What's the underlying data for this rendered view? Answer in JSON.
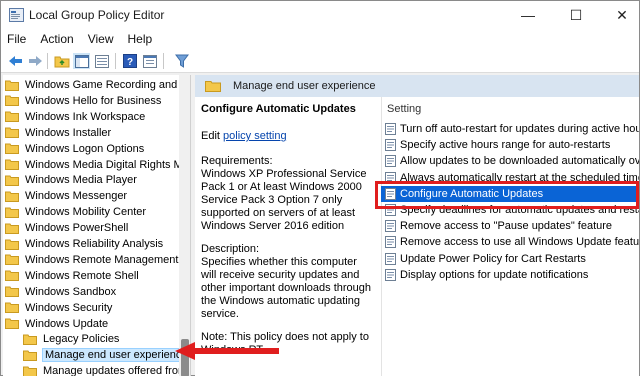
{
  "window": {
    "title": "Local Group Policy Editor",
    "controls": {
      "minimize": "—",
      "maximize": "☐",
      "close": "✕"
    }
  },
  "menu": [
    "File",
    "Action",
    "View",
    "Help"
  ],
  "toolbar": {
    "icons": [
      "back-arrow-icon",
      "forward-arrow-icon",
      "up-folder-icon",
      "show-hide-tree-icon",
      "export-icon",
      "help-icon",
      "properties-icon",
      "filter-icon"
    ]
  },
  "tree": {
    "items": [
      {
        "label": "Windows Game Recording and B",
        "level": 0
      },
      {
        "label": "Windows Hello for Business",
        "level": 0
      },
      {
        "label": "Windows Ink Workspace",
        "level": 0
      },
      {
        "label": "Windows Installer",
        "level": 0
      },
      {
        "label": "Windows Logon Options",
        "level": 0
      },
      {
        "label": "Windows Media Digital Rights M",
        "level": 0
      },
      {
        "label": "Windows Media Player",
        "level": 0
      },
      {
        "label": "Windows Messenger",
        "level": 0
      },
      {
        "label": "Windows Mobility Center",
        "level": 0
      },
      {
        "label": "Windows PowerShell",
        "level": 0
      },
      {
        "label": "Windows Reliability Analysis",
        "level": 0
      },
      {
        "label": "Windows Remote Management (",
        "level": 0
      },
      {
        "label": "Windows Remote Shell",
        "level": 0
      },
      {
        "label": "Windows Sandbox",
        "level": 0
      },
      {
        "label": "Windows Security",
        "level": 0
      },
      {
        "label": "Windows Update",
        "level": 0
      },
      {
        "label": "Legacy Policies",
        "level": 1
      },
      {
        "label": "Manage end user experience",
        "level": 1,
        "selected": true
      },
      {
        "label": "Manage updates offered fron",
        "level": 1
      }
    ]
  },
  "header": {
    "title": "Manage end user experience"
  },
  "description": {
    "title": "Configure Automatic Updates",
    "edit_prefix": "Edit ",
    "edit_link": "policy setting",
    "requirements_label": "Requirements:",
    "requirements_text": "Windows XP Professional Service Pack 1 or At least Windows 2000 Service Pack 3 Option 7 only supported on servers of at least Windows Server 2016 edition",
    "description_label": "Description:",
    "description_text": "Specifies whether this computer will receive security updates and other important downloads through the Windows automatic updating service.",
    "note_text": "Note: This policy does not apply to Windows RT."
  },
  "settings": {
    "column_header": "Setting",
    "items": [
      {
        "label": "Turn off auto-restart for updates during active hours"
      },
      {
        "label": "Specify active hours range for auto-restarts"
      },
      {
        "label": "Allow updates to be downloaded automatically over"
      },
      {
        "label": "Always automatically restart at the scheduled time"
      },
      {
        "label": "Configure Automatic Updates",
        "selected": true
      },
      {
        "label": "Specify deadlines for automatic updates and restarts"
      },
      {
        "label": "Remove access to \"Pause updates\" feature"
      },
      {
        "label": "Remove access to use all Windows Update features"
      },
      {
        "label": "Update Power Policy for Cart Restarts"
      },
      {
        "label": "Display options for update notifications"
      }
    ]
  },
  "colors": {
    "selection": "#0a64d6",
    "tree_selection": "#cce8ff",
    "header_band": "#d8e4f1",
    "annotation_red": "#e01e1e",
    "folder_yellow": "#f3c74a"
  }
}
